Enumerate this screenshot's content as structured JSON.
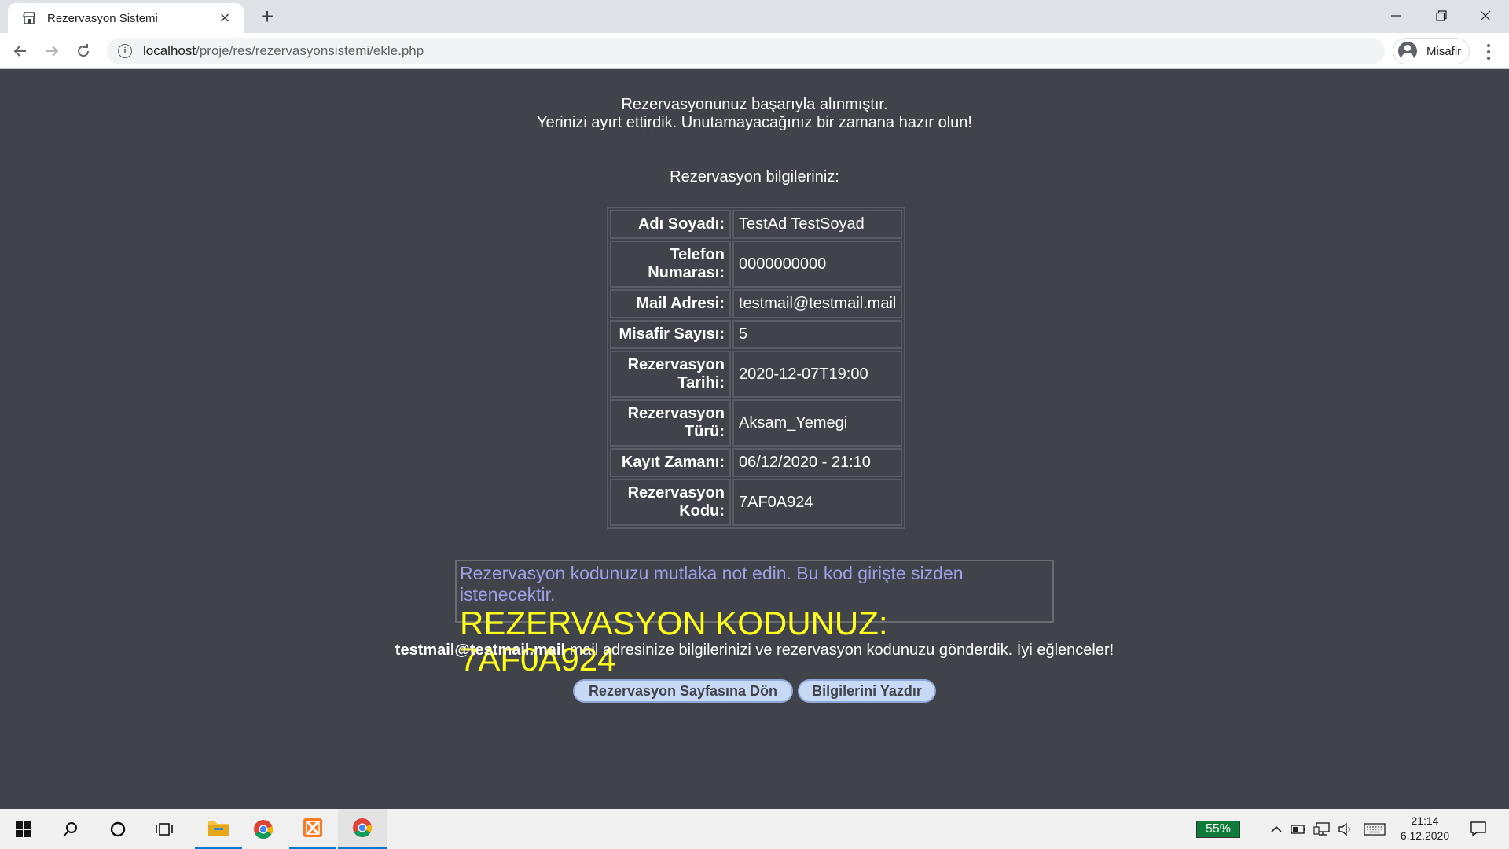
{
  "browser": {
    "tab_title": "Rezervasyon Sistemi",
    "tab_close": "×",
    "new_tab": "+",
    "url_host": "localhost",
    "url_path": "/proje/res/rezervasyonsistemi/ekle.php",
    "profile_label": "Misafir"
  },
  "page": {
    "success_line1": "Rezervasyonunuz başarıyla alınmıştır.",
    "success_line2": "Yerinizi ayırt ettirdik. Unutamayacağınız bir zamana hazır olun!",
    "info_heading": "Rezervasyon bilgileriniz:",
    "table": [
      {
        "label": "Adı Soyadı:",
        "value": "TestAd TestSoyad"
      },
      {
        "label": "Telefon Numarası:",
        "value": "0000000000"
      },
      {
        "label": "Mail Adresi:",
        "value": "testmail@testmail.mail"
      },
      {
        "label": "Misafir Sayısı:",
        "value": "5"
      },
      {
        "label": "Rezervasyon Tarihi:",
        "value": "2020-12-07T19:00"
      },
      {
        "label": "Rezervasyon Türü:",
        "value": "Aksam_Yemegi"
      },
      {
        "label": "Kayıt Zamanı:",
        "value": "06/12/2020 - 21:10"
      },
      {
        "label": "Rezervasyon Kodu:",
        "value": "7AF0A924"
      }
    ],
    "code_note": "Rezervasyon kodunuzu mutlaka not edin. Bu kod girişte sizden istenecektir.",
    "code_line": "REZERVASYON KODUNUZ: 7AF0A924",
    "mail_address": "testmail@testmail.mail",
    "mail_text": " mail adresinize bilgilerinizi ve rezervasyon kodunuzu gönderdik. İyi eğlenceler!",
    "back_button": "Rezervasyon Sayfasına Dön",
    "print_button": "Bilgilerini Yazdır"
  },
  "taskbar": {
    "battery": "55%",
    "time": "21:14",
    "date": "6.12.2020"
  },
  "colors": {
    "page_bg": "#41434a",
    "note_text": "#9f9fe6",
    "code_text": "#ffff1e",
    "button_bg": "#c8d9f5"
  }
}
